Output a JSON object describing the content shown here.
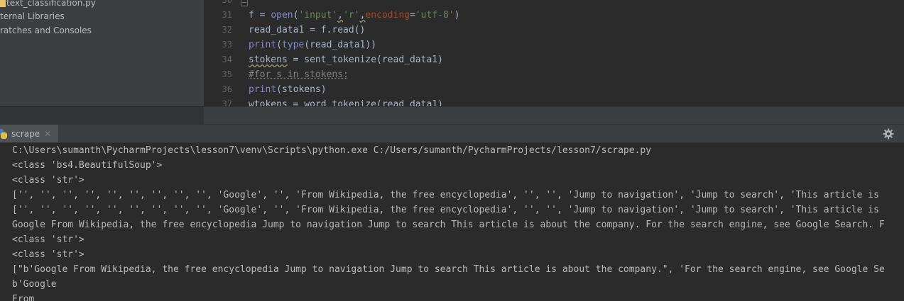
{
  "project": {
    "items": [
      {
        "label": "text_classification.py"
      },
      {
        "label": "ternal Libraries"
      },
      {
        "label": "ratches and Consoles"
      }
    ]
  },
  "editor": {
    "line_numbers": [
      "30",
      "31",
      "32",
      "33",
      "34",
      "35",
      "36",
      "37"
    ],
    "lines": [
      {
        "tokens": [
          {
            "t": "\"\"\"",
            "c": "str"
          }
        ]
      },
      {
        "tokens": [
          {
            "t": "f = "
          },
          {
            "t": "open",
            "c": "kw-fn"
          },
          {
            "t": "("
          },
          {
            "t": "'input'",
            "c": "str"
          },
          {
            "t": ",",
            "c": "warn"
          },
          {
            "t": "'r'",
            "c": "str"
          },
          {
            "t": ",",
            "c": "warn"
          },
          {
            "t": "encoding",
            "c": "param"
          },
          {
            "t": "="
          },
          {
            "t": "'utf-8'",
            "c": "str"
          },
          {
            "t": ")"
          }
        ]
      },
      {
        "tokens": [
          {
            "t": "read_data1 = f.read()"
          }
        ]
      },
      {
        "tokens": [
          {
            "t": "print",
            "c": "kw-fn"
          },
          {
            "t": "("
          },
          {
            "t": "type",
            "c": "kw-fn"
          },
          {
            "t": "(read_data1))"
          }
        ]
      },
      {
        "tokens": [
          {
            "t": "stokens",
            "c": "warn"
          },
          {
            "t": " = sent_tokenize(read_data1)"
          }
        ]
      },
      {
        "tokens": [
          {
            "t": "#for s in stokens:",
            "c": "com"
          }
        ]
      },
      {
        "tokens": [
          {
            "t": "print",
            "c": "kw-fn"
          },
          {
            "t": "(stokens)"
          }
        ]
      },
      {
        "tokens": [
          {
            "t": "wtokens = word_tokenize(read_data1)"
          }
        ]
      }
    ]
  },
  "run": {
    "tab_label": "scrape",
    "close_glyph": "✕",
    "settings_icon": "gear-icon",
    "output": [
      "C:\\Users\\sumanth\\PycharmProjects\\lesson7\\venv\\Scripts\\python.exe C:/Users/sumanth/PycharmProjects/lesson7/scrape.py",
      "<class 'bs4.BeautifulSoup'>",
      "<class 'str'>",
      "['', '', '', '', '', '', '', '', '', 'Google', '', 'From Wikipedia, the free encyclopedia', '', '', 'Jump to navigation', 'Jump to search', 'This article is",
      "['', '', '', '', '', '', '', '', '', 'Google', '', 'From Wikipedia, the free encyclopedia', '', '', 'Jump to navigation', 'Jump to search', 'This article is",
      "Google From Wikipedia, the free encyclopedia Jump to navigation Jump to search This article is about the company. For the search engine, see Google Search. F",
      "<class 'str'>",
      "<class 'str'>",
      "[\"b'Google From Wikipedia, the free encyclopedia Jump to navigation Jump to search This article is about the company.\", 'For the search engine, see Google Se",
      "b'Google",
      "From"
    ]
  },
  "colors": {
    "background": "#2b2b2b",
    "panel": "#3c3f41",
    "text": "#bbbbbb",
    "string": "#6a8759",
    "builtin": "#8888c6",
    "param": "#aa4926"
  }
}
